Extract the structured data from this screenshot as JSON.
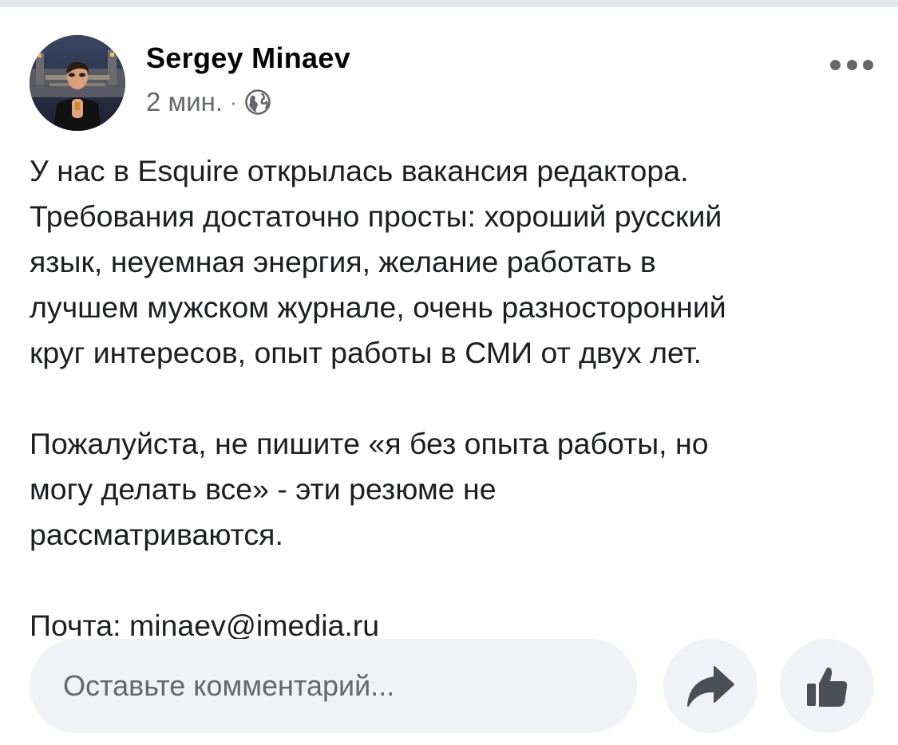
{
  "post": {
    "author": "Sergey Minaev",
    "time": "2 мин.",
    "separator": "·",
    "audience_icon": "globe-icon",
    "more_icon": "more-options-icon",
    "paragraph_1": [
      "У нас в Esquire открылась вакансия редактора.",
      "Требования достаточно просты: хороший русский",
      "язык, неуемная энергия, желание работать в",
      "лучшем мужском журнале, очень разносторонний",
      "круг интересов, опыт работы в СМИ от двух лет."
    ],
    "paragraph_2": [
      "Пожалуйста, не пишите «я без опыта работы,  но",
      "могу делать все» - эти резюме не",
      "рассматриваются."
    ],
    "paragraph_3": [
      "Почта: minaev@imedia.ru"
    ]
  },
  "comment": {
    "placeholder": "Оставьте комментарий...",
    "value": ""
  },
  "actions": {
    "share_icon": "share-arrow-icon",
    "like_icon": "thumbs-up-icon"
  },
  "colors": {
    "text": "#1c1e21",
    "secondary_text": "#65676b",
    "input_background": "#f0f2f5",
    "icon": "#4b4f56"
  }
}
